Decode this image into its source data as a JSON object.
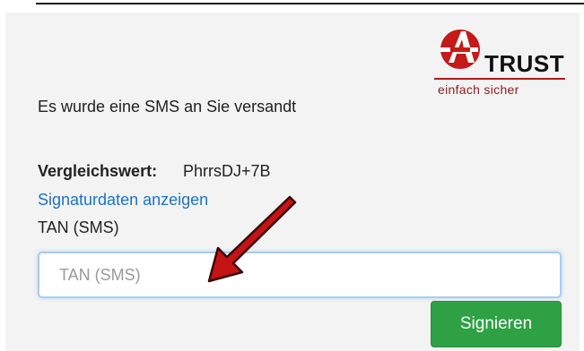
{
  "logo": {
    "brand": "TRUST",
    "tagline": "einfach sicher",
    "icon": "a-trust-logo-icon",
    "brand_color": "#c41a1a"
  },
  "message": {
    "sms_sent": "Es wurde eine SMS an Sie versandt"
  },
  "comparison": {
    "label": "Vergleichswert:",
    "value": "PhrrsDJ+7B"
  },
  "signature_link": "Signaturdaten anzeigen",
  "tan": {
    "label": "TAN (SMS)",
    "placeholder": "TAN (SMS)",
    "value": ""
  },
  "sign_button": {
    "label": "Signieren",
    "color": "#2ea145"
  },
  "annotation": {
    "icon": "red-arrow-icon",
    "color": "#c41414"
  }
}
